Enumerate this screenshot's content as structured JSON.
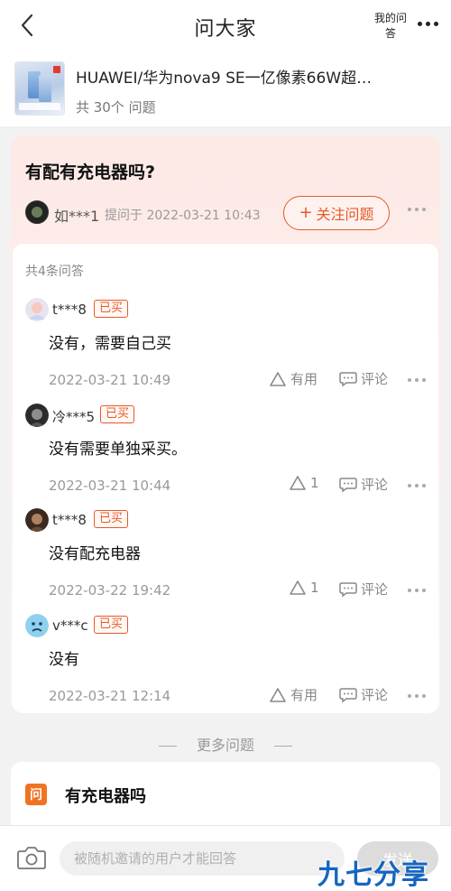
{
  "header": {
    "title": "问大家",
    "my_answers": "我的问答"
  },
  "product": {
    "title": "HUAWEI/华为nova9 SE一亿像素66W超…",
    "question_count": "共 30个 问题"
  },
  "question": {
    "title": "有配有充电器吗?",
    "asker_name": "如***1",
    "asked_meta": "提问于 2022-03-21 10:43",
    "follow_label": "关注问题",
    "follow_plus": "+"
  },
  "answers_count": "共4条问答",
  "badge_label": "已买",
  "comment_label": "评论",
  "answers": [
    {
      "user": "t***8",
      "text": "没有，需要自己买",
      "date": "2022-03-21 10:49",
      "like": "有用"
    },
    {
      "user": "冷***5",
      "text": "没有需要单独采买。",
      "date": "2022-03-21 10:44",
      "like": "1"
    },
    {
      "user": "t***8",
      "text": "没有配充电器",
      "date": "2022-03-22 19:42",
      "like": "1"
    },
    {
      "user": "v***c",
      "text": "没有",
      "date": "2022-03-21 12:14",
      "like": "有用"
    }
  ],
  "more_questions_label": "更多问题",
  "related": {
    "icon_text": "问",
    "title": "有充电器吗"
  },
  "reply": {
    "placeholder": "被随机邀请的用户才能回答",
    "send_label": "发送"
  },
  "watermark": "九七分享吧",
  "colors": {
    "accent": "#e65a28",
    "ask_icon": "#f07322",
    "watermark": "#1565c0"
  }
}
